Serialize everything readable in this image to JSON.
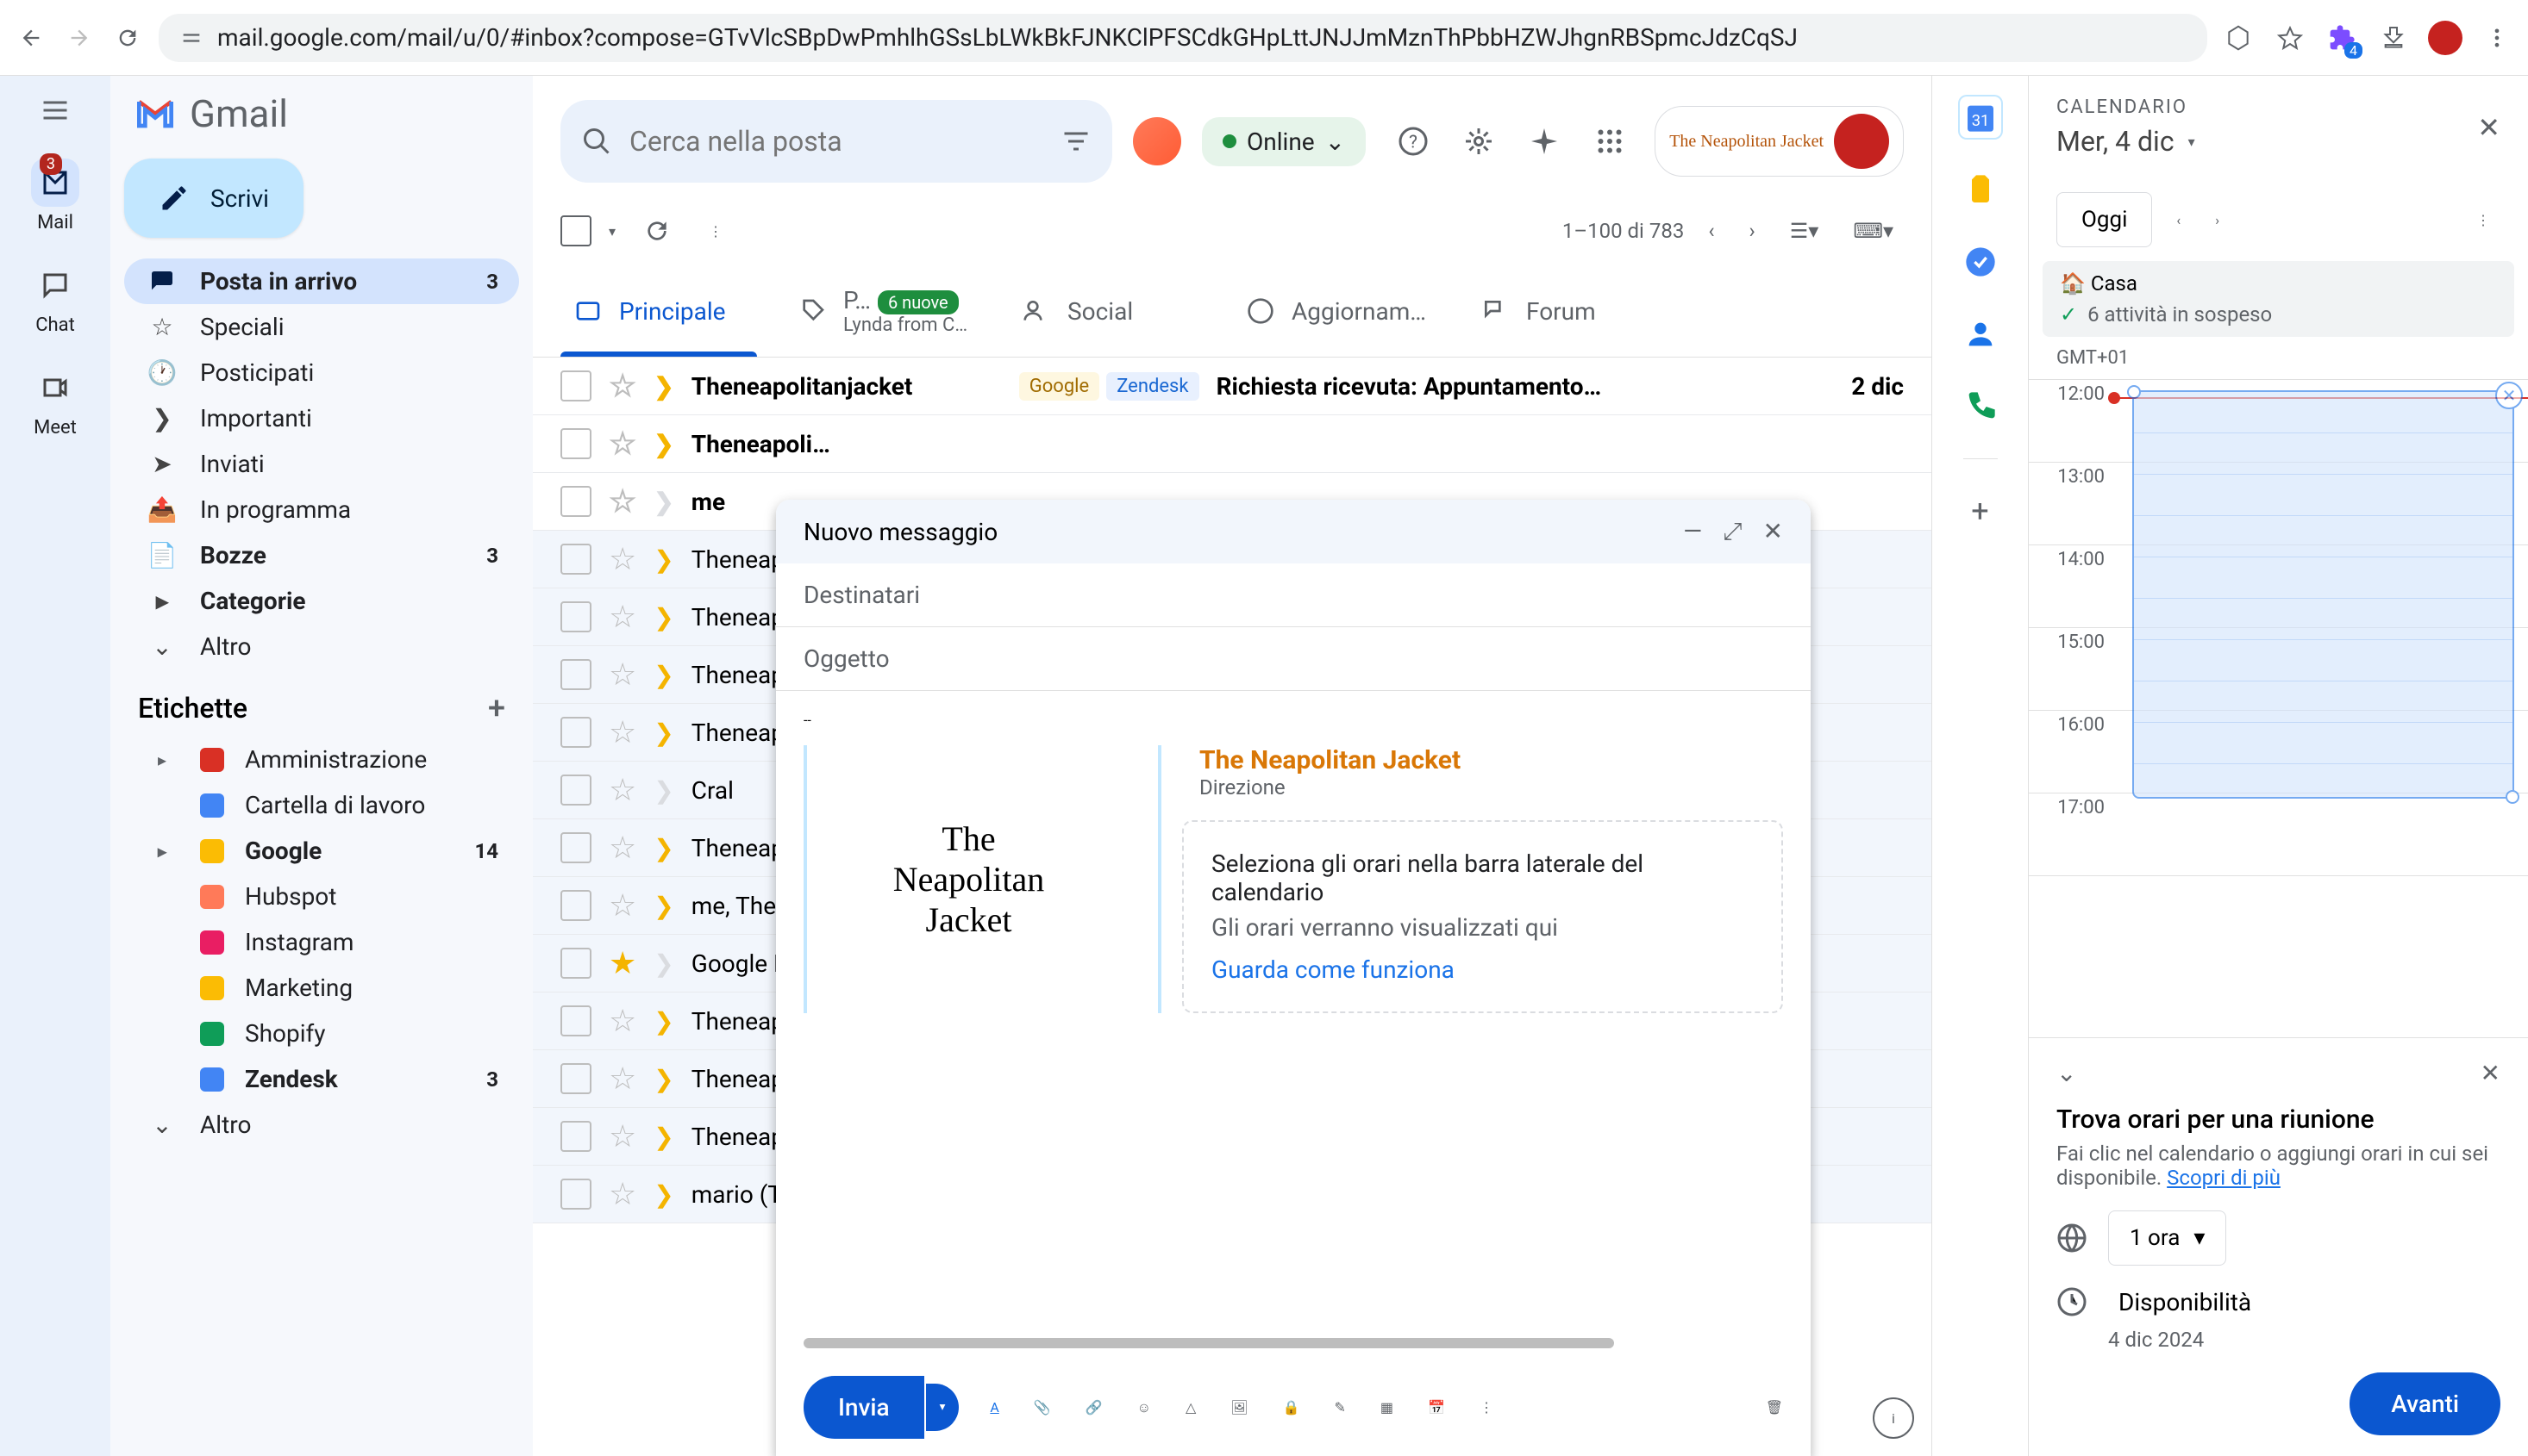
{
  "browser": {
    "url": "mail.google.com/mail/u/0/#inbox?compose=GTvVlcSBpDwPmhlhGSsLbLWkBkFJNKClPFSCdkGHpLttJNJJmMznThPbbHZWJhgnRBSpmcJdzCqSJ",
    "ext_badge": "4"
  },
  "rail": {
    "mail": "Mail",
    "mail_badge": "3",
    "chat": "Chat",
    "meet": "Meet"
  },
  "gmail": {
    "brand": "Gmail",
    "compose": "Scrivi",
    "search_placeholder": "Cerca nella posta",
    "online": "Online",
    "page_info": "1–100 di 783"
  },
  "nav": {
    "inbox": "Posta in arrivo",
    "inbox_count": "3",
    "starred": "Speciali",
    "snoozed": "Posticipati",
    "important": "Importanti",
    "sent": "Inviati",
    "scheduled": "In programma",
    "drafts": "Bozze",
    "drafts_count": "3",
    "categories": "Categorie",
    "more": "Altro"
  },
  "labels": {
    "header": "Etichette",
    "items": [
      {
        "name": "Amministrazione",
        "color": "#d93025"
      },
      {
        "name": "Cartella di lavoro",
        "color": "#4285f4"
      },
      {
        "name": "Google",
        "color": "#fbbc04",
        "count": "14",
        "bold": true
      },
      {
        "name": "Hubspot",
        "color": "#ff7a59"
      },
      {
        "name": "Instagram",
        "color": "#e91e63"
      },
      {
        "name": "Marketing",
        "color": "#fbbc04"
      },
      {
        "name": "Shopify",
        "color": "#0f9d58"
      },
      {
        "name": "Zendesk",
        "color": "#4285f4",
        "count": "3",
        "bold": true
      }
    ],
    "more": "Altro"
  },
  "tabs": {
    "primary": "Principale",
    "promo": "P…",
    "promo_badge": "6 nuove",
    "promo_sub": "Lynda from C…",
    "social": "Social",
    "updates": "Aggiornam…",
    "forums": "Forum"
  },
  "emails": [
    {
      "sender": "Theneapolitanjacket",
      "labels": [
        "Google",
        "Zendesk"
      ],
      "subject": "Richiesta ricevuta: Appuntamento…",
      "date": "2 dic",
      "unread": true,
      "important": true
    },
    {
      "sender": "Theneapoli…",
      "labels": [],
      "subject": "",
      "date": "",
      "unread": true,
      "important": true
    },
    {
      "sender": "me",
      "labels": [],
      "subject": "",
      "date": "",
      "unread": true,
      "important": false
    },
    {
      "sender": "Theneapoli…",
      "labels": [],
      "subject": "",
      "date": "",
      "unread": false,
      "important": true
    },
    {
      "sender": "Theneapoli…",
      "labels": [],
      "subject": "",
      "date": "",
      "unread": false,
      "important": true
    },
    {
      "sender": "Theneapoli…",
      "labels": [],
      "subject": "",
      "date": "",
      "unread": false,
      "important": true
    },
    {
      "sender": "Theneapoli…",
      "labels": [],
      "subject": "",
      "date": "",
      "unread": false,
      "important": true
    },
    {
      "sender": "Cral",
      "labels": [],
      "subject": "",
      "date": "",
      "unread": false,
      "important": false
    },
    {
      "sender": "Theneapoli…",
      "labels": [],
      "subject": "",
      "date": "",
      "unread": false,
      "important": true
    },
    {
      "sender": "me, Thenea…",
      "labels": [],
      "subject": "",
      "date": "",
      "unread": false,
      "important": true
    },
    {
      "sender": "Google M…",
      "labels": [],
      "subject": "",
      "date": "",
      "unread": false,
      "important": false,
      "starred": true
    },
    {
      "sender": "Theneapo.,…",
      "labels": [],
      "subject": "",
      "date": "",
      "unread": false,
      "important": true
    },
    {
      "sender": "Theneapoli…",
      "labels": [],
      "subject": "",
      "date": "",
      "unread": false,
      "important": true
    },
    {
      "sender": "Theneapoli…",
      "labels": [],
      "subject": "",
      "date": "",
      "unread": false,
      "important": true
    },
    {
      "sender": "mario (The…",
      "labels": [],
      "subject": "",
      "date": "",
      "unread": false,
      "important": true
    }
  ],
  "compose": {
    "title": "Nuovo messaggio",
    "to": "Destinatari",
    "subject": "Oggetto",
    "sig_dash": "--",
    "sig_name": "The Neapolitan Jacket",
    "sig_role": "Direzione",
    "cal_hint_title": "Seleziona gli orari nella barra laterale del calendario",
    "cal_hint_sub": "Gli orari verranno visualizzati qui",
    "cal_hint_link": "Guarda come funziona",
    "send": "Invia"
  },
  "calendar": {
    "title": "CALENDARIO",
    "date": "Mer, 4 dic",
    "today": "Oggi",
    "home": "Casa",
    "pending": "6 attività in sospeso",
    "tz": "GMT+01",
    "hours": [
      "12:00",
      "13:00",
      "14:00",
      "15:00",
      "16:00",
      "17:00"
    ],
    "meet_title": "Trova orari per una riunione",
    "meet_sub": "Fai clic nel calendario o aggiungi orari in cui sei disponibile. ",
    "meet_link": "Scopri di più",
    "duration": "1 ora",
    "availability": "Disponibilità",
    "avail_date": "4 dic 2024",
    "next": "Avanti"
  }
}
